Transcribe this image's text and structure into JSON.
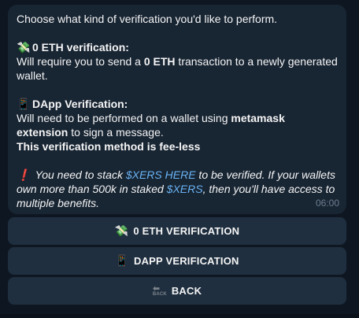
{
  "message": {
    "intro": "Choose what kind of verification you'd like to perform.",
    "eth_section": {
      "icon": "money-with-wings-icon",
      "icon_glyph": "💸",
      "title": "0 ETH verification:",
      "line_prefix": "Will require you to send a ",
      "line_bold": "0 ETH",
      "line_suffix": " transaction to a newly generated wallet."
    },
    "dapp_section": {
      "icon": "mobile-phone-icon",
      "icon_glyph": "📱",
      "title": "DApp Verification:",
      "line_prefix": "Will need to be performed on a wallet using ",
      "line_bold": "metamask extension",
      "line_suffix": " to sign a message.",
      "fee_note": "This verification method is fee-less"
    },
    "warning": {
      "icon": "exclamation-icon",
      "icon_glyph": "❗",
      "text_1": " You need to stack ",
      "link_1": "$XERS HERE",
      "text_2": " to be verified. If your wallets own more than 500k in staked ",
      "link_2": "$XERS",
      "text_3": ", then you'll have access to multiple benefits."
    },
    "time": "06:00"
  },
  "keyboard": {
    "eth_button": {
      "icon_glyph": "💸",
      "label": "0 ETH VERIFICATION"
    },
    "dapp_button": {
      "icon_glyph": "📱",
      "label": "DAPP VERIFICATION"
    },
    "back_button": {
      "icon_glyph": "🔙",
      "icon_word": "BACK",
      "label": "BACK"
    }
  },
  "colors": {
    "background": "#0e1621",
    "bubble": "#182533",
    "button": "#1f2f3f",
    "link": "#6ab3f3",
    "warning": "#e53935",
    "timestamp": "#6d7f8f"
  }
}
